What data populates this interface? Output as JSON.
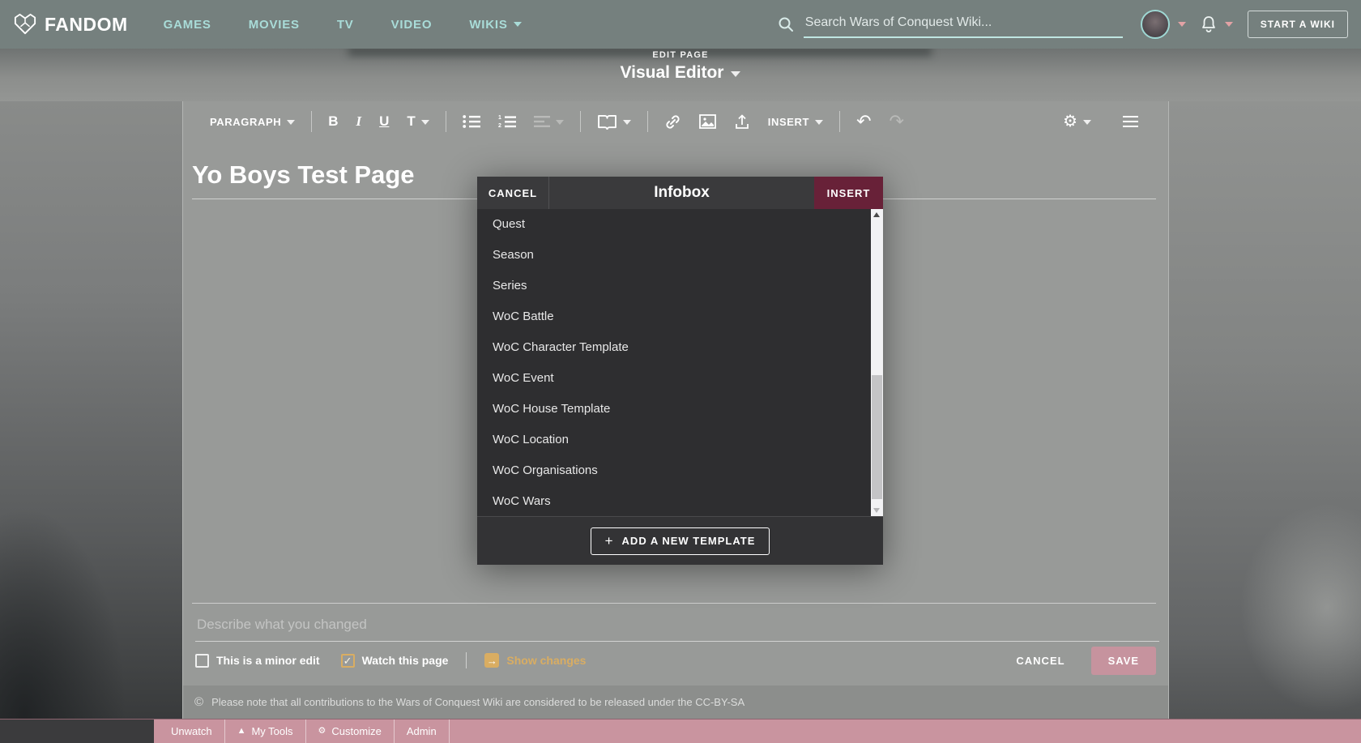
{
  "navbar": {
    "brand": "FANDOM",
    "links": [
      {
        "label": "GAMES"
      },
      {
        "label": "MOVIES"
      },
      {
        "label": "TV"
      },
      {
        "label": "VIDEO"
      },
      {
        "label": "WIKIS",
        "caret": true
      }
    ],
    "search": {
      "placeholder": "Search Wars of Conquest Wiki..."
    },
    "start_wiki_label": "START A WIKI"
  },
  "page_header": {
    "kicker": "EDIT PAGE",
    "mode": "Visual Editor"
  },
  "editor_toolbar": {
    "paragraph_label": "PARAGRAPH",
    "bold_label": "B",
    "italic_label": "I",
    "underline_label": "U",
    "textstyle_label": "T",
    "insert_label": "INSERT"
  },
  "article": {
    "title": "Yo Boys Test Page"
  },
  "dialog": {
    "cancel_label": "CANCEL",
    "title": "Infobox",
    "insert_label": "INSERT",
    "templates": [
      "Quest",
      "Season",
      "Series",
      "WoC Battle",
      "WoC Character Template",
      "WoC Event",
      "WoC House Template",
      "WoC Location",
      "WoC Organisations",
      "WoC Wars"
    ],
    "add_template_label": "ADD A NEW TEMPLATE",
    "plus_icon": "+"
  },
  "save_panel": {
    "summary_placeholder": "Describe what you changed",
    "minor_edit_label": "This is a minor edit",
    "minor_edit_checked": false,
    "watch_label": "Watch this page",
    "watch_checked": true,
    "watch_check_glyph": "✓",
    "show_changes_label": "Show changes",
    "show_changes_icon": "→",
    "cancel_label": "CANCEL",
    "save_label": "SAVE"
  },
  "footer": {
    "copyright_glyph": "©",
    "notice": "Please note that all contributions to the Wars of Conquest Wiki are considered to be released under the CC-BY-SA"
  },
  "bottom_toolbar": {
    "items": [
      {
        "label": "Unwatch",
        "icon": ""
      },
      {
        "label": "My Tools",
        "icon": "▲"
      },
      {
        "label": "Customize",
        "icon": "⚙"
      },
      {
        "label": "Admin",
        "icon": ""
      }
    ]
  },
  "icons": {
    "toolbar_settings_glyph": "⚙",
    "undo_glyph": "↶",
    "redo_glyph": "↷"
  },
  "colors": {
    "navbar_bg": "#75807e",
    "nav_link": "#a9dcd8",
    "content_bg": "#989a98",
    "dialog_header": "#3a3a3c",
    "dialog_body": "#2e2e30",
    "insert_maroon": "#682138",
    "accent_gold": "#d9ad62",
    "save_pink": "#c6939e",
    "bottom_bar_pink": "#c9949f"
  }
}
